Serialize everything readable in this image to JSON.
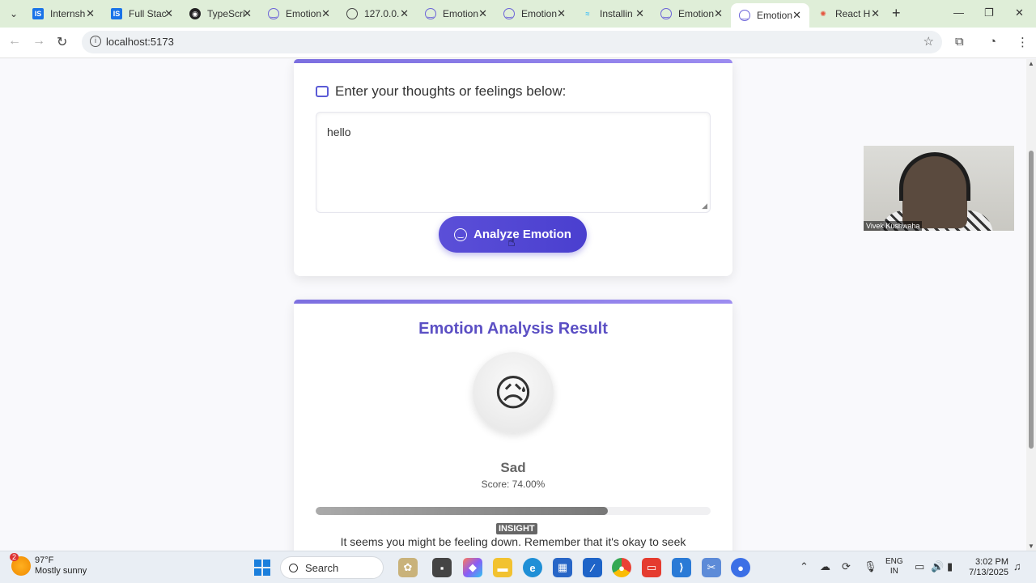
{
  "browser": {
    "tabs": [
      {
        "title": "Internsh",
        "favicon": "is-logo-icon"
      },
      {
        "title": "Full Stac",
        "favicon": "is-logo-icon"
      },
      {
        "title": "TypeScri",
        "favicon": "typescript-icon"
      },
      {
        "title": "Emotion",
        "favicon": "smile-icon"
      },
      {
        "title": "127.0.0.",
        "favicon": "globe-icon"
      },
      {
        "title": "Emotion",
        "favicon": "smile-icon"
      },
      {
        "title": "Emotion",
        "favicon": "smile-icon"
      },
      {
        "title": "Installin",
        "favicon": "tailwind-icon"
      },
      {
        "title": "Emotion",
        "favicon": "smile-icon"
      },
      {
        "title": "Emotion",
        "favicon": "smile-icon",
        "active": true
      },
      {
        "title": "React H",
        "favicon": "react-icon"
      }
    ],
    "url": "localhost:5173"
  },
  "input_card": {
    "prompt": "Enter your thoughts or feelings below:",
    "textarea_value": "hello",
    "analyze_button": "Analyze Emotion"
  },
  "result_card": {
    "title": "Emotion Analysis Result",
    "emoji": "😥",
    "emotion": "Sad",
    "score_text": "Score: 74.00%",
    "score_fraction": 0.74,
    "insight_badge": "INSIGHT",
    "insight_text": "It seems you might be feeling down. Remember that it's okay to seek"
  },
  "video_overlay": {
    "name": "Vivek Kushwaha"
  },
  "taskbar": {
    "weather_badge": "2",
    "temperature": "97°F",
    "condition": "Mostly sunny",
    "search_label": "Search",
    "lang_line1": "ENG",
    "lang_line2": "IN",
    "time": "3:02 PM",
    "date": "7/13/2025"
  },
  "colors": {
    "accent": "#5b4fd8",
    "result_title": "#5b4fc4",
    "tab_strip": "#dfeed8"
  }
}
